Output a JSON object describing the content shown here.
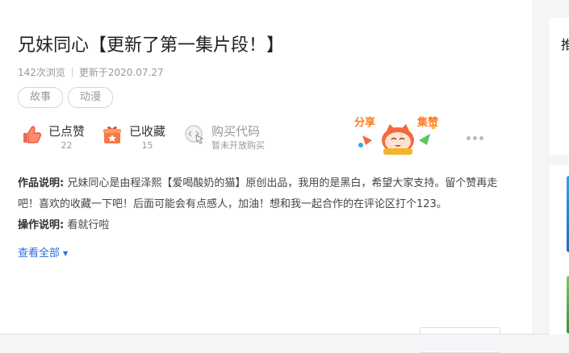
{
  "work": {
    "title": "兄妹同心【更新了第一集片段！】",
    "views": "142次浏览",
    "updated": "更新于2020.07.27",
    "tags": [
      "故事",
      "动漫"
    ]
  },
  "actions": {
    "like": {
      "label": "已点赞",
      "count": "22",
      "icon": "thumbs-up-icon"
    },
    "favorite": {
      "label": "已收藏",
      "count": "15",
      "icon": "gift-box-icon"
    },
    "buy": {
      "label": "购买代码",
      "sub": "暂未开放购买",
      "icon": "code-cursor-icon"
    },
    "share_banner": {
      "left": "分享",
      "right": "集赞"
    },
    "more_icon": "more-dots-icon"
  },
  "description": {
    "work_label": "作品说明:",
    "work_text": " 兄妹同心是由程泽熙【爱喝酸奶的猫】原创出品，我用的是黑白，希望大家支持。留个赞再走吧！喜欢的收藏一下吧！后面可能会有点感人，加油！想和我一起合作的在评论区打个123。",
    "op_label": "操作说明:",
    "op_text": " 看就行啦",
    "view_all": "查看全部"
  },
  "sidebar": {
    "heading_char": "推"
  },
  "colors": {
    "link": "#2d6cdf",
    "accent": "#e8542d",
    "tag_border": "#d6d6d6"
  }
}
